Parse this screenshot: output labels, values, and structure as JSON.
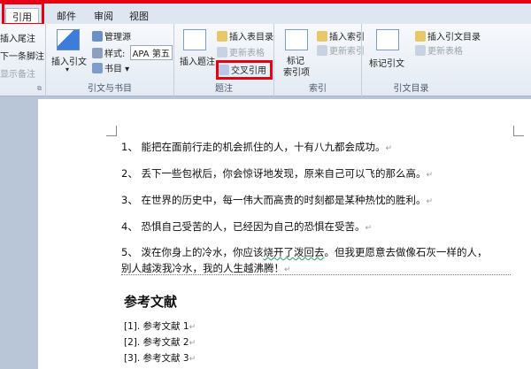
{
  "tabs": [
    "引用",
    "邮件",
    "审阅",
    "视图"
  ],
  "ribbon": {
    "footnote_group": {
      "items": [
        "插入尾注",
        "下一条脚注",
        "显示备注"
      ]
    },
    "citations_group": {
      "insert_citation": "插入引文",
      "manage_sources": "管理源",
      "style_label": "样式:",
      "style_value": "APA 第五",
      "bibliography": "书目",
      "label": "引文与书目"
    },
    "captions_group": {
      "insert_caption": "插入题注",
      "insert_table_of_figures": "插入表目录",
      "update_table": "更新表格",
      "cross_reference": "交叉引用",
      "label": "题注"
    },
    "index_group": {
      "mark_entry": "标记",
      "mark_entry_line2": "索引项",
      "insert_index": "插入索引",
      "update_index": "更新索引",
      "label": "索引"
    },
    "toa_group": {
      "mark_citation": "标记引文",
      "insert_toa": "插入引文目录",
      "update_table": "更新表格",
      "label": "引文目录"
    }
  },
  "document": {
    "paragraphs": [
      "1、  能把在面前行走的机会抓住的人，十有八九都会成功。",
      "2、  丢下一些包袱后，你会惊讶地发现，原来自己可以飞的那么高。",
      "3、  在世界的历史中，每一伟大而高贵的时刻都是某种热忱的胜利。",
      "4、  恐惧自己受苦的人，已经因为自己的恐惧在受苦。"
    ],
    "para5_line1_a": "5、  泼在你身上的冷水，你应该",
    "para5_line1_b": "烧开了泼回去",
    "para5_line1_c": "。但我更愿意去做像石灰一样的人，",
    "para5_line2": "别人越泼我冷水，我的人生越沸腾！",
    "heading": "参考文献",
    "references": [
      "[1].  参考文献 1",
      "[2].  参考文献 2",
      "[3].  参考文献 3"
    ],
    "para_mark": "↵"
  }
}
